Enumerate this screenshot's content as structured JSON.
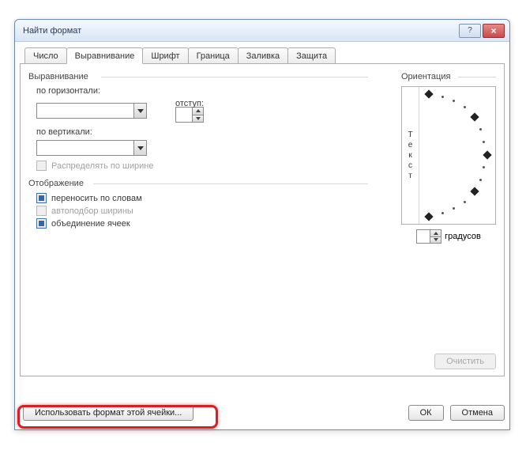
{
  "window": {
    "title": "Найти формат"
  },
  "tabs": [
    "Число",
    "Выравнивание",
    "Шрифт",
    "Граница",
    "Заливка",
    "Защита"
  ],
  "align": {
    "group_title": "Выравнивание",
    "horizontal_label": "по горизонтали:",
    "vertical_label": "по вертикали:",
    "indent_label": "отступ:",
    "distribute_label": "Распределять по ширине"
  },
  "display": {
    "group_title": "Отображение",
    "wrap_label": "переносить по словам",
    "autofit_label": "автоподбор ширины",
    "merge_label": "объединение ячеек"
  },
  "orientation": {
    "title": "Ориентация",
    "text_vertical": [
      "Т",
      "е",
      "к",
      "с",
      "т"
    ],
    "degrees_label": "градусов"
  },
  "buttons": {
    "clear": "Очистить",
    "use_format": "Использовать формат этой ячейки...",
    "ok": "ОК",
    "cancel": "Отмена"
  }
}
